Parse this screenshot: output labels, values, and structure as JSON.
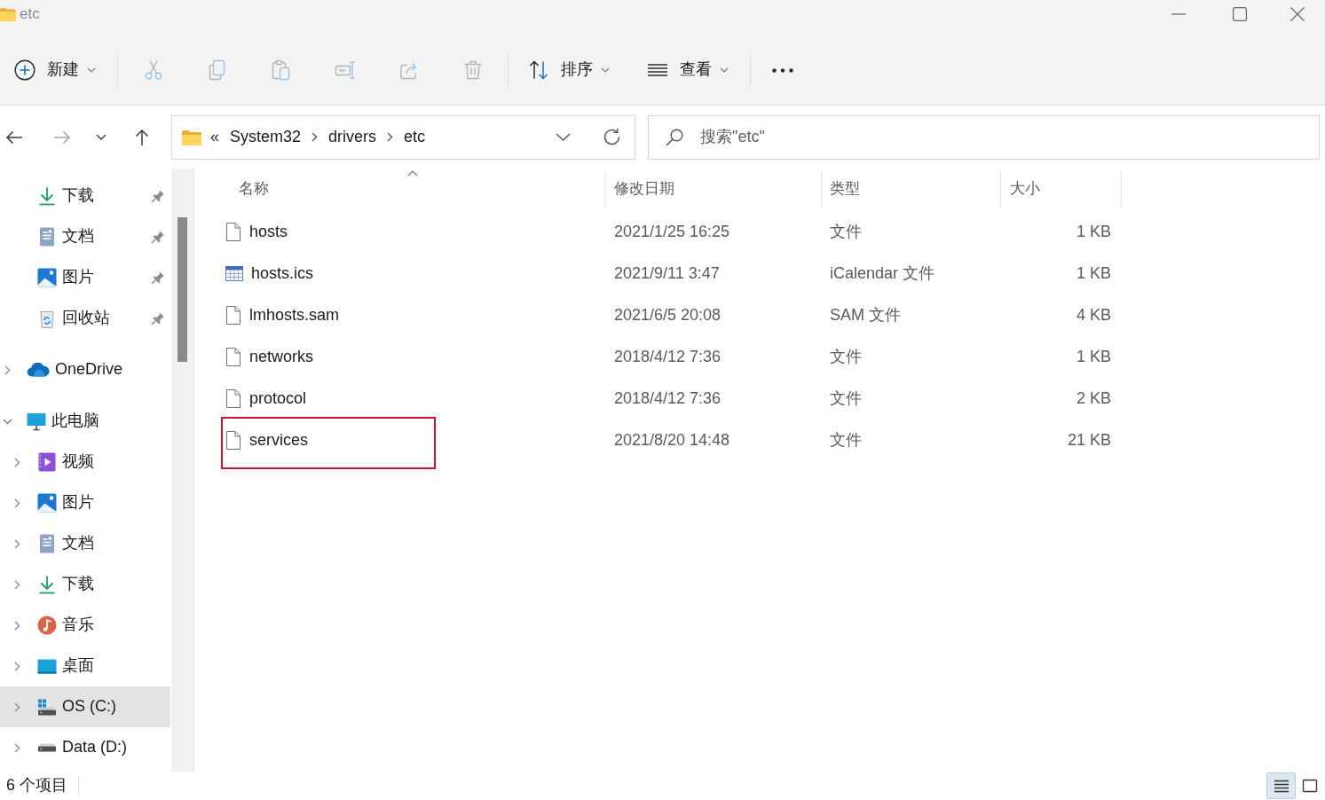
{
  "window": {
    "title": "etc"
  },
  "toolbar": {
    "groups": [
      [
        {
          "label": "新建",
          "dropdown": true,
          "disabled": false
        }
      ],
      [
        {
          "disabled": true
        },
        {
          "disabled": true
        },
        {
          "disabled": true
        },
        {
          "disabled": true
        },
        {
          "disabled": true
        },
        {
          "disabled": true
        }
      ],
      [
        {
          "label": "排序",
          "dropdown": true,
          "disabled": false
        },
        {
          "label": "查看",
          "dropdown": true,
          "disabled": false
        }
      ],
      [
        {
          "disabled": false
        }
      ]
    ]
  },
  "navigation": [
    {
      "disabled": false
    },
    {
      "disabled": true
    },
    {
      "disabled": false
    },
    {
      "disabled": false
    }
  ],
  "address": {
    "overflow": "«",
    "crumbs": [
      "System32",
      "drivers",
      "etc"
    ]
  },
  "search": {
    "placeholder": "搜索\"etc\""
  },
  "sidebar": {
    "pinned": [
      {
        "kind": "downloads",
        "label": "下载",
        "pinned": true,
        "selected": false
      },
      {
        "kind": "documents",
        "label": "文档",
        "pinned": true,
        "selected": false
      },
      {
        "kind": "pictures",
        "label": "图片",
        "pinned": true,
        "selected": false
      },
      {
        "kind": "recycle",
        "label": "回收站",
        "pinned": true,
        "selected": false
      }
    ],
    "tree": [
      {
        "kind": "cloud",
        "label": "OneDrive",
        "expanded": false,
        "selected": false
      },
      {
        "kind": "computer",
        "label": "此电脑",
        "expanded": true,
        "selected": false,
        "children": [
          {
            "kind": "videos",
            "label": "视频",
            "expanded": false,
            "selected": false
          },
          {
            "kind": "pictures",
            "label": "图片",
            "expanded": false,
            "selected": false
          },
          {
            "kind": "documents",
            "label": "文档",
            "expanded": false,
            "selected": false
          },
          {
            "kind": "downloads",
            "label": "下载",
            "expanded": false,
            "selected": false
          },
          {
            "kind": "music",
            "label": "音乐",
            "expanded": false,
            "selected": false
          },
          {
            "kind": "desktop",
            "label": "桌面",
            "expanded": false,
            "selected": false
          },
          {
            "kind": "systemdrive",
            "label": "OS (C:)",
            "expanded": false,
            "selected": true
          },
          {
            "kind": "drive",
            "label": "Data (D:)",
            "expanded": false,
            "selected": false
          }
        ]
      }
    ]
  },
  "columns": [
    {
      "label": "名称",
      "sorted": true
    },
    {
      "label": "修改日期",
      "sorted": false
    },
    {
      "label": "类型",
      "sorted": false
    },
    {
      "label": "大小",
      "sorted": false
    }
  ],
  "files": [
    {
      "kind": "file",
      "name": "hosts",
      "modified": "2021/1/25 16:25",
      "type": "文件",
      "size": "1 KB",
      "selected": false,
      "highlighted": false
    },
    {
      "kind": "calendar",
      "name": "hosts.ics",
      "modified": "2021/9/11 3:47",
      "type": "iCalendar 文件",
      "size": "1 KB",
      "selected": false,
      "highlighted": false
    },
    {
      "kind": "file",
      "name": "lmhosts.sam",
      "modified": "2021/6/5 20:08",
      "type": "SAM 文件",
      "size": "4 KB",
      "selected": false,
      "highlighted": false
    },
    {
      "kind": "file",
      "name": "networks",
      "modified": "2018/4/12 7:36",
      "type": "文件",
      "size": "1 KB",
      "selected": false,
      "highlighted": false
    },
    {
      "kind": "file",
      "name": "protocol",
      "modified": "2018/4/12 7:36",
      "type": "文件",
      "size": "2 KB",
      "selected": false,
      "highlighted": false
    },
    {
      "kind": "file",
      "name": "services",
      "modified": "2021/8/20 14:48",
      "type": "文件",
      "size": "21 KB",
      "selected": false,
      "highlighted": true
    }
  ],
  "status_bar": {
    "count": "6 个项目",
    "views": [
      {
        "selected": true
      },
      {
        "selected": false
      }
    ]
  }
}
